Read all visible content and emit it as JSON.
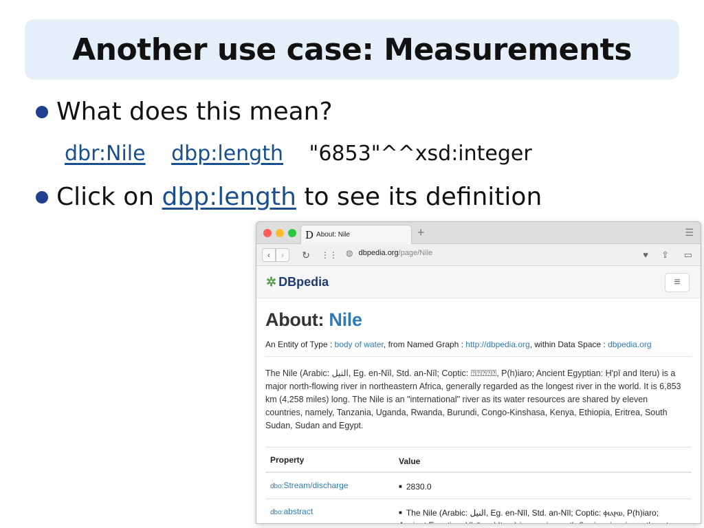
{
  "slide": {
    "title": "Another use case: Measurements",
    "bullet1": "What does this mean?",
    "triple": {
      "subject": "dbr:Nile",
      "predicate": "dbp:length",
      "object": "\"6853\"^^xsd:integer"
    },
    "bullet2": {
      "before": "Click on",
      "link": "dbp:length",
      "after": "to see its definition"
    }
  },
  "browser": {
    "tab_favicon": "D",
    "tab_title": "About: Nile",
    "new_tab": "+",
    "url_host": "dbpedia.org",
    "url_path": "/page/Nile",
    "icons": {
      "back": "chevron-left-icon",
      "forward": "chevron-right-icon",
      "reload": "reload-icon",
      "grid": "grid-icon",
      "globe": "globe-icon",
      "heart": "heart-icon",
      "share": "share-icon",
      "battery": "battery-icon",
      "menu": "hamburger-icon"
    }
  },
  "page": {
    "logo": "DBpedia",
    "about_prefix": "About:",
    "about_name": "Nile",
    "entity": {
      "t1": "An Entity of Type :",
      "type": "body of water",
      "t2": ", from Named Graph :",
      "graph": "http://dbpedia.org",
      "t3": ", within Data Space :",
      "space": "dbpedia.org"
    },
    "abstract": "The Nile (Arabic: النيل, Eg. en-Nīl, Std. an-Nīl; Coptic: ⍰⍰⍰⍰⍰, P(h)iaro; Ancient Egyptian: Ḥ'pī and Iteru) is a major north-flowing river in northeastern Africa, generally regarded as the longest river in the world. It is 6,853 km (4,258 miles) long. The Nile is an \"international\" river as its water resources are shared by eleven countries, namely, Tanzania, Uganda, Rwanda, Burundi, Congo-Kinshasa, Kenya, Ethiopia, Eritrea, South Sudan, Sudan and Egypt.",
    "table": {
      "col_property": "Property",
      "col_value": "Value",
      "rows": [
        {
          "prefix": "dbo:",
          "name": "Stream/discharge",
          "value": "2830.0"
        },
        {
          "prefix": "dbo:",
          "name": "abstract",
          "value": "The Nile (Arabic: النيل, Eg. en-Nīl, Std. an-Nīl; Coptic: ⲫⲓⲁⲣⲱ, P(h)iaro; Ancient Egyptian: Ḥ'pī and Iteru) is a major north-flowing river in northeastern Africa,"
        }
      ]
    }
  }
}
